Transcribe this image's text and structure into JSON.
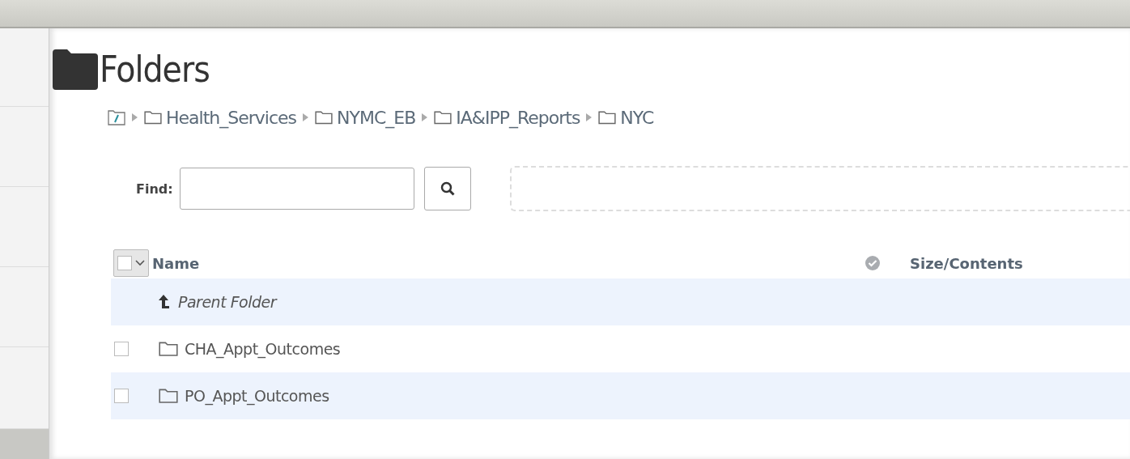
{
  "title": "Folders",
  "breadcrumb": [
    {
      "label": "Health_Services"
    },
    {
      "label": "NYMC_EB"
    },
    {
      "label": "IA&IPP_Reports"
    },
    {
      "label": "NYC"
    }
  ],
  "find": {
    "label": "Find:"
  },
  "table": {
    "select_all": {
      "checked": false
    },
    "columns": [
      "Name",
      "Size/Contents"
    ],
    "rows": [
      {
        "kind": "parent",
        "name": "Parent Folder"
      },
      {
        "kind": "folder",
        "name": "CHA_Appt_Outcomes",
        "checked": false
      },
      {
        "kind": "folder",
        "name": "PO_Appt_Outcomes",
        "checked": false
      }
    ]
  }
}
